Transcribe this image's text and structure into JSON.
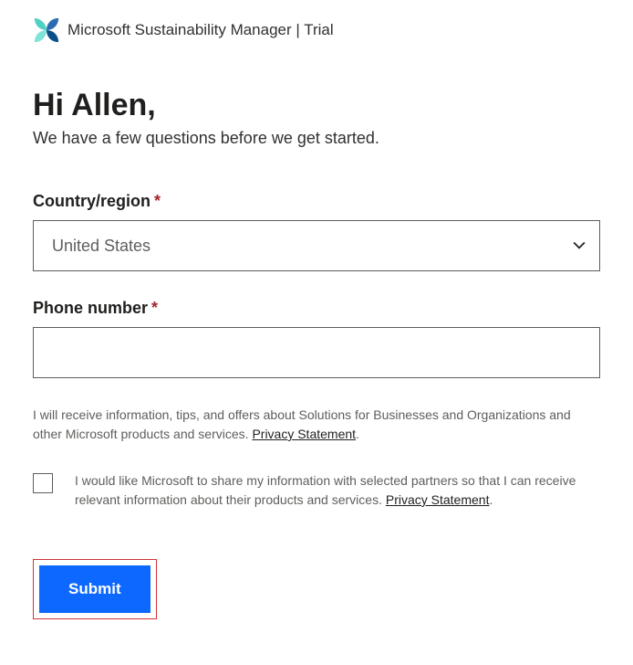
{
  "header": {
    "title": "Microsoft Sustainability Manager | Trial"
  },
  "greeting": "Hi Allen,",
  "subheading": "We have a few questions before we get started.",
  "form": {
    "country": {
      "label": "Country/region",
      "value": "United States"
    },
    "phone": {
      "label": "Phone number",
      "value": ""
    },
    "consent_text_1": "I will receive information, tips, and offers about Solutions for Businesses and Organizations and other Microsoft products and services. ",
    "privacy_link": "Privacy Statement",
    "checkbox_label": "I would like Microsoft to share my information with selected partners so that I can receive relevant information about their products and services. ",
    "submit_label": "Submit"
  }
}
